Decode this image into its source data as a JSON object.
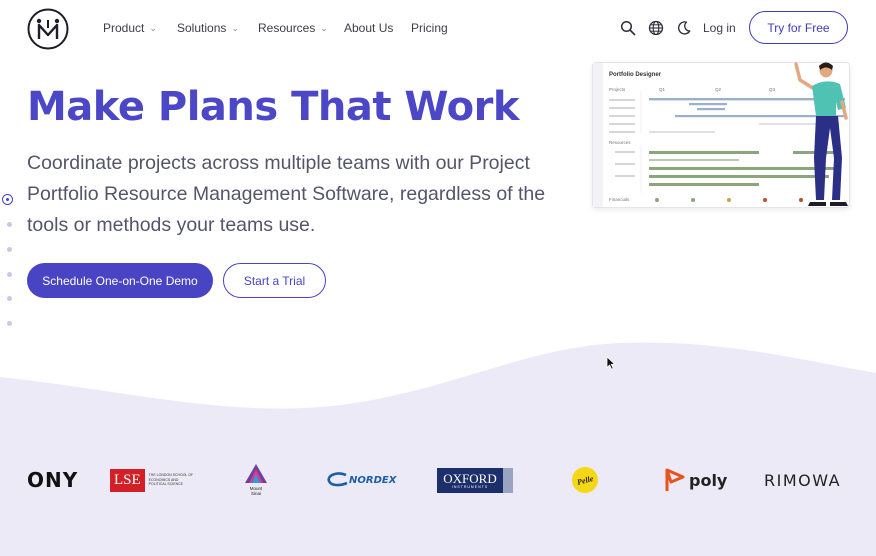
{
  "brand": {
    "logo_icon": "m-monogram-logo"
  },
  "nav": {
    "items": [
      {
        "label": "Product",
        "dropdown": true
      },
      {
        "label": "Solutions",
        "dropdown": true
      },
      {
        "label": "Resources",
        "dropdown": true
      },
      {
        "label": "About Us",
        "dropdown": false
      },
      {
        "label": "Pricing",
        "dropdown": false
      }
    ],
    "icons": [
      "search-icon",
      "globe-icon",
      "moon-icon"
    ],
    "login_label": "Log in",
    "cta_label": "Try for Free"
  },
  "hero": {
    "title": "Make Plans That Work",
    "subtitle": "Coordinate projects across multiple teams with our Project Portfolio Resource Management Software, regardless of the tools or methods your teams use.",
    "primary_button": "Schedule One-on-One Demo",
    "secondary_button": "Start a Trial",
    "slide_dots": {
      "count": 6,
      "active_index": 0
    }
  },
  "illustration": {
    "card_title": "Portfolio Designer",
    "section_projects": "Projects",
    "section_resources": "Resources",
    "section_financials": "Financials",
    "quarters": [
      "Q1",
      "Q2",
      "Q3"
    ]
  },
  "client_logos": [
    {
      "name": "SONY",
      "label": "ONY"
    },
    {
      "name": "LSE",
      "label": "LSE",
      "sub": "THE LONDON SCHOOL OF ECONOMICS AND POLITICAL SCIENCE"
    },
    {
      "name": "Mount Sinai",
      "label": "Mount Sinai"
    },
    {
      "name": "Nordex",
      "label": "NORDEX"
    },
    {
      "name": "Oxford Instruments",
      "label": "OXFORD",
      "sub": "INSTRUMENTS"
    },
    {
      "name": "Pelle",
      "label": "Pelle"
    },
    {
      "name": "Poly",
      "label": "poly"
    },
    {
      "name": "Rimowa",
      "label": "RIMOWA"
    }
  ],
  "colors": {
    "accent": "#4844c4",
    "title": "#4b47c6",
    "wave_bg": "#eceaf7"
  }
}
